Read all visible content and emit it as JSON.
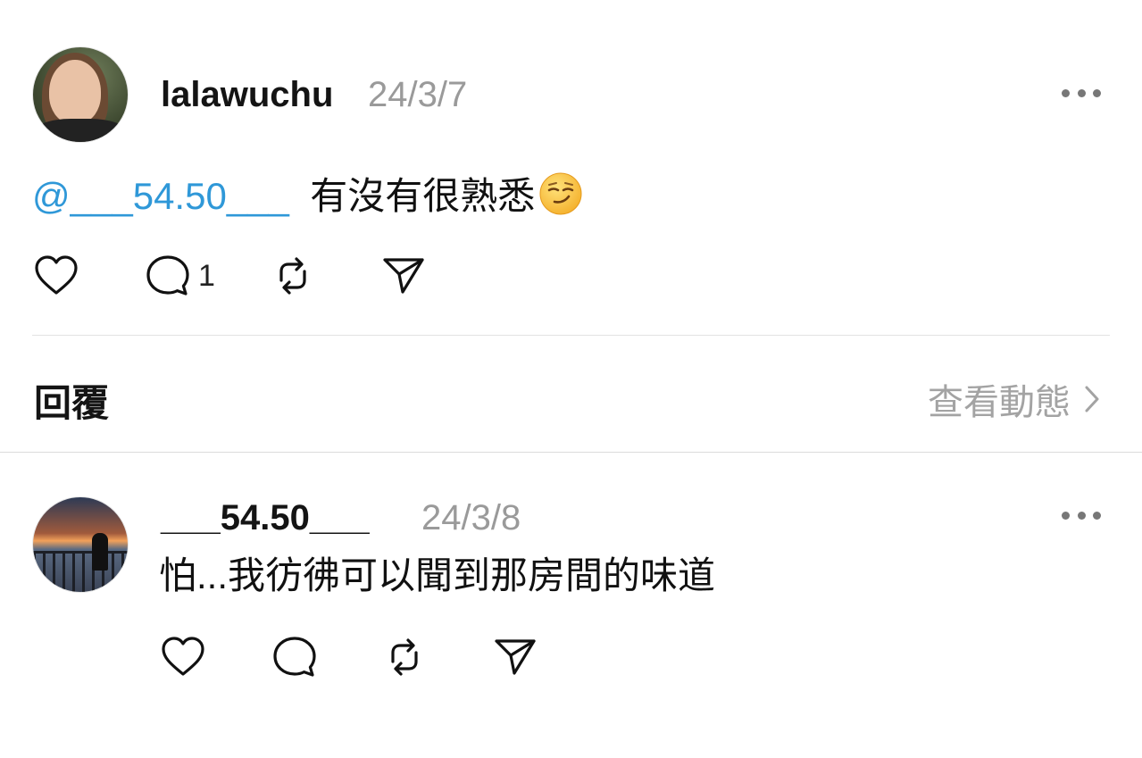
{
  "post": {
    "username": "lalawuchu",
    "date": "24/3/7",
    "mention": "@___54.50___",
    "text": "有沒有很熟悉",
    "emoji": "smirking-face-emoji",
    "comment_count": "1"
  },
  "replies_section": {
    "title": "回覆",
    "view_activity": "查看動態"
  },
  "reply": {
    "username": "___54.50___",
    "date": "24/3/8",
    "text": "怕...我彷彿可以聞到那房間的味道"
  },
  "icons": [
    "heart-icon",
    "comment-icon",
    "repost-icon",
    "share-icon",
    "more-icon",
    "chevron-right-icon"
  ],
  "colors": {
    "mention": "#2f98d8",
    "secondary_text": "#9a9a9a",
    "primary_text": "#141414"
  }
}
